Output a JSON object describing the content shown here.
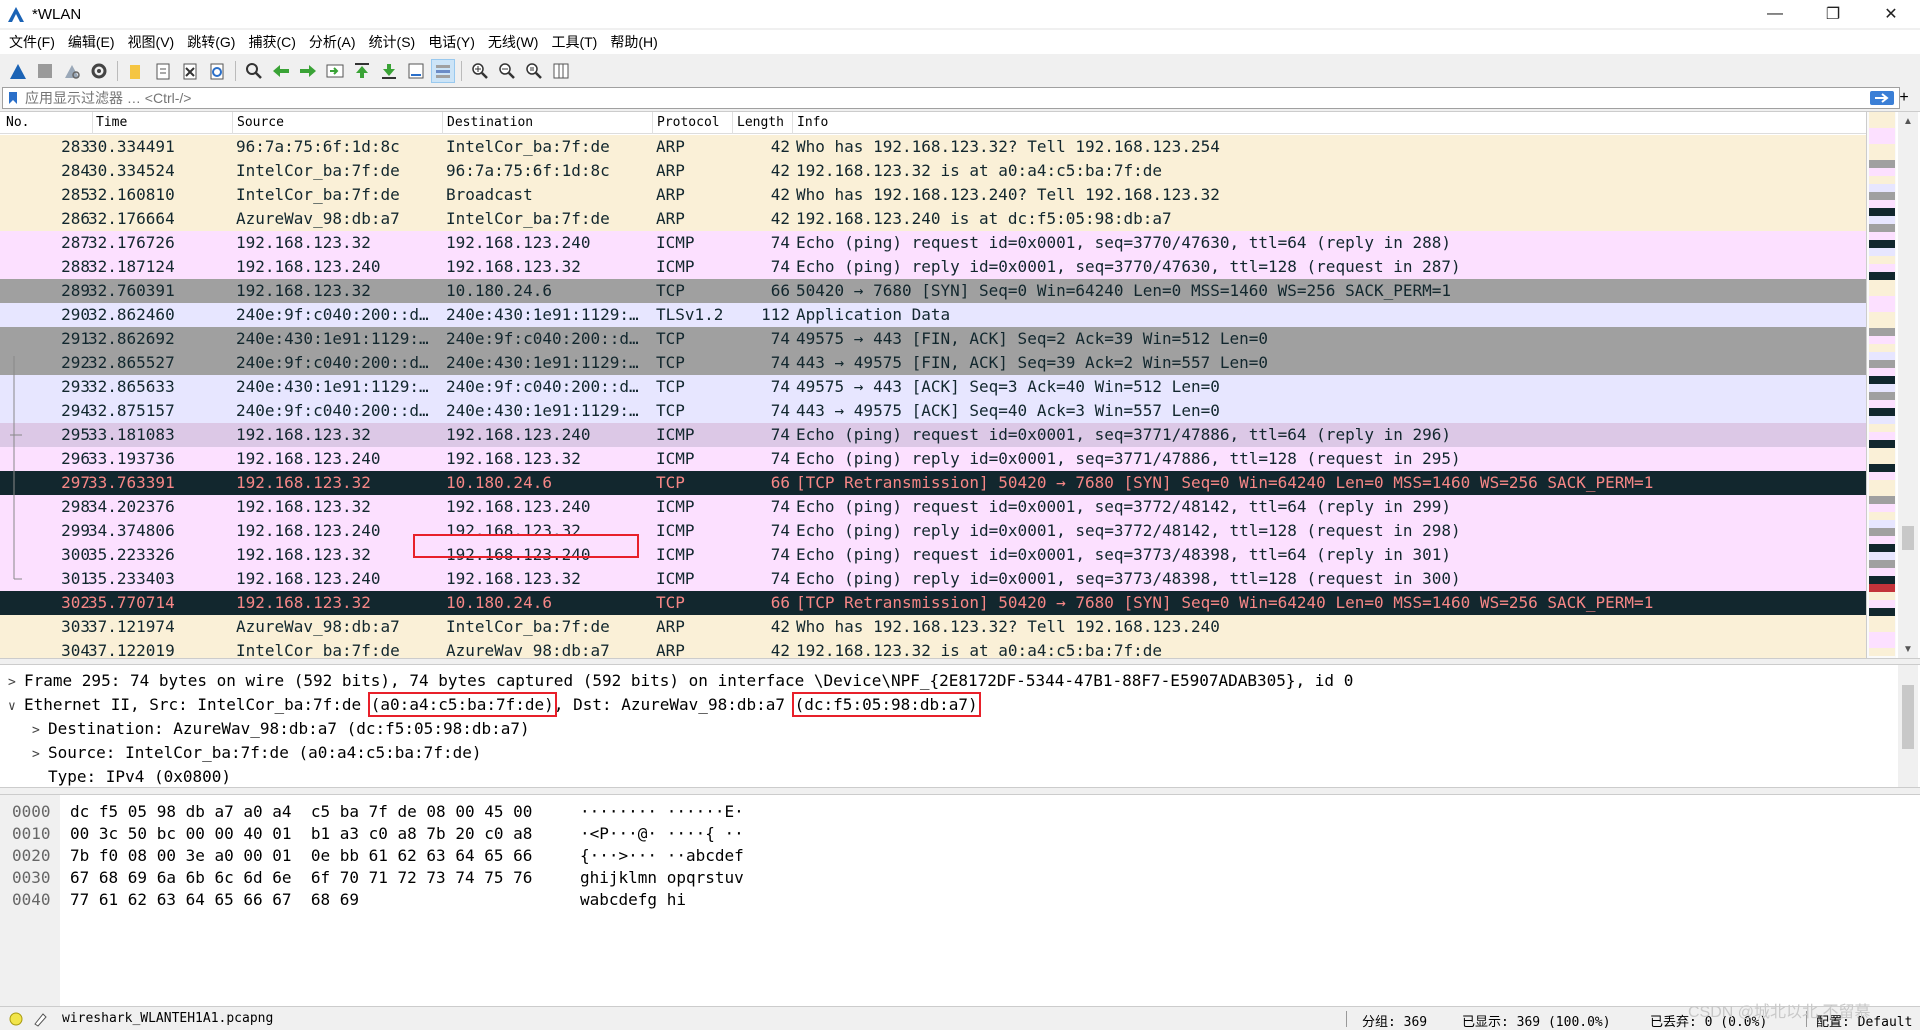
{
  "window": {
    "title": "*WLAN",
    "minimize": "—",
    "maximize": "❐",
    "close": "✕"
  },
  "menu": [
    "文件(F)",
    "编辑(E)",
    "视图(V)",
    "跳转(G)",
    "捕获(C)",
    "分析(A)",
    "统计(S)",
    "电话(Y)",
    "无线(W)",
    "工具(T)",
    "帮助(H)"
  ],
  "filter": {
    "placeholder": "应用显示过滤器 … <Ctrl-/>",
    "value": "",
    "plus": "+"
  },
  "columns": {
    "no": "No.",
    "time": "Time",
    "source": "Source",
    "destination": "Destination",
    "protocol": "Protocol",
    "length": "Length",
    "info": "Info"
  },
  "colors": {
    "arp": "#faf0d7",
    "icmp": "#fce0ff",
    "tcp_syn": "#a0a0a0",
    "tcp_gray": "#a0a0a0",
    "tls": "#e7e6ff",
    "tcp_ack": "#e7e6ff",
    "bad": "#12272e",
    "bad_fg": "#f78787",
    "selected": "#dcc8e6",
    "highlight": "#e8202a"
  },
  "packets": [
    {
      "no": "283",
      "time": "30.334491",
      "src": "96:7a:75:6f:1d:8c",
      "dst": "IntelCor_ba:7f:de",
      "proto": "ARP",
      "len": "42",
      "info": "Who has 192.168.123.32? Tell 192.168.123.254",
      "style": "arp"
    },
    {
      "no": "284",
      "time": "30.334524",
      "src": "IntelCor_ba:7f:de",
      "dst": "96:7a:75:6f:1d:8c",
      "proto": "ARP",
      "len": "42",
      "info": "192.168.123.32 is at a0:a4:c5:ba:7f:de",
      "style": "arp"
    },
    {
      "no": "285",
      "time": "32.160810",
      "src": "IntelCor_ba:7f:de",
      "dst": "Broadcast",
      "proto": "ARP",
      "len": "42",
      "info": "Who has 192.168.123.240? Tell 192.168.123.32",
      "style": "arp"
    },
    {
      "no": "286",
      "time": "32.176664",
      "src": "AzureWav_98:db:a7",
      "dst": "IntelCor_ba:7f:de",
      "proto": "ARP",
      "len": "42",
      "info": "192.168.123.240 is at dc:f5:05:98:db:a7",
      "style": "arp"
    },
    {
      "no": "287",
      "time": "32.176726",
      "src": "192.168.123.32",
      "dst": "192.168.123.240",
      "proto": "ICMP",
      "len": "74",
      "info": "Echo (ping) request  id=0x0001, seq=3770/47630, ttl=64 (reply in 288)",
      "style": "icmp"
    },
    {
      "no": "288",
      "time": "32.187124",
      "src": "192.168.123.240",
      "dst": "192.168.123.32",
      "proto": "ICMP",
      "len": "74",
      "info": "Echo (ping) reply    id=0x0001, seq=3770/47630, ttl=128 (request in 287)",
      "style": "icmp"
    },
    {
      "no": "289",
      "time": "32.760391",
      "src": "192.168.123.32",
      "dst": "10.180.24.6",
      "proto": "TCP",
      "len": "66",
      "info": "50420 → 7680 [SYN] Seq=0 Win=64240 Len=0 MSS=1460 WS=256 SACK_PERM=1",
      "style": "tcp_syn"
    },
    {
      "no": "290",
      "time": "32.862460",
      "src": "240e:9f:c040:200::d…",
      "dst": "240e:430:1e91:1129:…",
      "proto": "TLSv1.2",
      "len": "112",
      "info": "Application Data",
      "style": "tls"
    },
    {
      "no": "291",
      "time": "32.862692",
      "src": "240e:430:1e91:1129:…",
      "dst": "240e:9f:c040:200::d…",
      "proto": "TCP",
      "len": "74",
      "info": "49575 → 443 [FIN, ACK] Seq=2 Ack=39 Win=512 Len=0",
      "style": "tcp_gray"
    },
    {
      "no": "292",
      "time": "32.865527",
      "src": "240e:9f:c040:200::d…",
      "dst": "240e:430:1e91:1129:…",
      "proto": "TCP",
      "len": "74",
      "info": "443 → 49575 [FIN, ACK] Seq=39 Ack=2 Win=557 Len=0",
      "style": "tcp_gray"
    },
    {
      "no": "293",
      "time": "32.865633",
      "src": "240e:430:1e91:1129:…",
      "dst": "240e:9f:c040:200::d…",
      "proto": "TCP",
      "len": "74",
      "info": "49575 → 443 [ACK] Seq=3 Ack=40 Win=512 Len=0",
      "style": "tcp_ack"
    },
    {
      "no": "294",
      "time": "32.875157",
      "src": "240e:9f:c040:200::d…",
      "dst": "240e:430:1e91:1129:…",
      "proto": "TCP",
      "len": "74",
      "info": "443 → 49575 [ACK] Seq=40 Ack=3 Win=557 Len=0",
      "style": "tcp_ack"
    },
    {
      "no": "295",
      "time": "33.181083",
      "src": "192.168.123.32",
      "dst": "192.168.123.240",
      "proto": "ICMP",
      "len": "74",
      "info": "Echo (ping) request  id=0x0001, seq=3771/47886, ttl=64 (reply in 296)",
      "style": "selected"
    },
    {
      "no": "296",
      "time": "33.193736",
      "src": "192.168.123.240",
      "dst": "192.168.123.32",
      "proto": "ICMP",
      "len": "74",
      "info": "Echo (ping) reply    id=0x0001, seq=3771/47886, ttl=128 (request in 295)",
      "style": "icmp"
    },
    {
      "no": "297",
      "time": "33.763391",
      "src": "192.168.123.32",
      "dst": "10.180.24.6",
      "proto": "TCP",
      "len": "66",
      "info": "[TCP Retransmission] 50420 → 7680 [SYN] Seq=0 Win=64240 Len=0 MSS=1460 WS=256 SACK_PERM=1",
      "style": "bad"
    },
    {
      "no": "298",
      "time": "34.202376",
      "src": "192.168.123.32",
      "dst": "192.168.123.240",
      "proto": "ICMP",
      "len": "74",
      "info": "Echo (ping) request  id=0x0001, seq=3772/48142, ttl=64 (reply in 299)",
      "style": "icmp"
    },
    {
      "no": "299",
      "time": "34.374806",
      "src": "192.168.123.240",
      "dst": "192.168.123.32",
      "proto": "ICMP",
      "len": "74",
      "info": "Echo (ping) reply    id=0x0001, seq=3772/48142, ttl=128 (request in 298)",
      "style": "icmp"
    },
    {
      "no": "300",
      "time": "35.223326",
      "src": "192.168.123.32",
      "dst": "192.168.123.240",
      "proto": "ICMP",
      "len": "74",
      "info": "Echo (ping) request  id=0x0001, seq=3773/48398, ttl=64 (reply in 301)",
      "style": "icmp"
    },
    {
      "no": "301",
      "time": "35.233403",
      "src": "192.168.123.240",
      "dst": "192.168.123.32",
      "proto": "ICMP",
      "len": "74",
      "info": "Echo (ping) reply    id=0x0001, seq=3773/48398, ttl=128 (request in 300)",
      "style": "icmp"
    },
    {
      "no": "302",
      "time": "35.770714",
      "src": "192.168.123.32",
      "dst": "10.180.24.6",
      "proto": "TCP",
      "len": "66",
      "info": "[TCP Retransmission] 50420 → 7680 [SYN] Seq=0 Win=64240 Len=0 MSS=1460 WS=256 SACK_PERM=1",
      "style": "bad"
    },
    {
      "no": "303",
      "time": "37.121974",
      "src": "AzureWav_98:db:a7",
      "dst": "IntelCor_ba:7f:de",
      "proto": "ARP",
      "len": "42",
      "info": "Who has 192.168.123.32? Tell 192.168.123.240",
      "style": "arp"
    },
    {
      "no": "304",
      "time": "37.122019",
      "src": "IntelCor_ba:7f:de",
      "dst": "AzureWav_98:db:a7",
      "proto": "ARP",
      "len": "42",
      "info": "192.168.123.32 is at a0:a4:c5:ba:7f:de",
      "style": "arp"
    }
  ],
  "details": {
    "frame": "Frame 295: 74 bytes on wire (592 bits), 74 bytes captured (592 bits) on interface \\Device\\NPF_{2E8172DF-5344-47B1-88F7-E5907ADAB305}, id 0",
    "eth_prefix": "Ethernet II, Src: IntelCor_ba:7f:de ",
    "eth_src_mac": "(a0:a4:c5:ba:7f:de)",
    "eth_mid": ", Dst: AzureWav_98:db:a7 ",
    "eth_dst_mac": "(dc:f5:05:98:db:a7)",
    "destination": "Destination: AzureWav_98:db:a7 (dc:f5:05:98:db:a7)",
    "source": "Source: IntelCor_ba:7f:de (a0:a4:c5:ba:7f:de)",
    "type": "Type: IPv4 (0x0800)",
    "collapsed": ">",
    "expanded": "∨"
  },
  "bytes": [
    {
      "off": "0000",
      "hex": "dc f5 05 98 db a7 a0 a4  c5 ba 7f de 08 00 45 00",
      "ascii": "········ ······E·"
    },
    {
      "off": "0010",
      "hex": "00 3c 50 bc 00 00 40 01  b1 a3 c0 a8 7b 20 c0 a8",
      "ascii": "·<P···@· ····{ ··"
    },
    {
      "off": "0020",
      "hex": "7b f0 08 00 3e a0 00 01  0e bb 61 62 63 64 65 66",
      "ascii": "{···>··· ··abcdef"
    },
    {
      "off": "0030",
      "hex": "67 68 69 6a 6b 6c 6d 6e  6f 70 71 72 73 74 75 76",
      "ascii": "ghijklmn opqrstuv"
    },
    {
      "off": "0040",
      "hex": "77 61 62 63 64 65 66 67  68 69",
      "ascii": "wabcdefg hi"
    }
  ],
  "status": {
    "file": "wireshark_WLANTEH1A1.pcapng",
    "packets": "分组: 369",
    "displayed": "已显示: 369 (100.0%)",
    "dropped": "已丢弃: 0 (0.0%)",
    "profile": "配置: Default",
    "watermark": "CSDN @城北以北 不留慕"
  }
}
